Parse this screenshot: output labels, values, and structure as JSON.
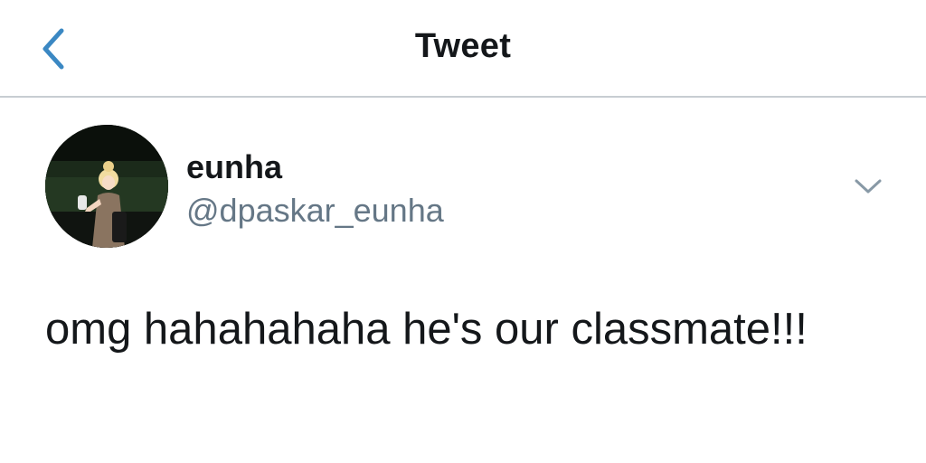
{
  "header": {
    "title": "Tweet",
    "back_icon": "chevron-left-icon",
    "accent_color": "#3b88c3"
  },
  "tweet": {
    "author": {
      "display_name": "eunha",
      "handle": "@dpaskar_eunha",
      "avatar_icon": "profile-photo"
    },
    "menu_icon": "chevron-down-icon",
    "text": "omg hahahahaha he's our classmate!!!"
  },
  "colors": {
    "text_primary": "#14171a",
    "text_secondary": "#657786",
    "divider": "#c8cdd2"
  }
}
